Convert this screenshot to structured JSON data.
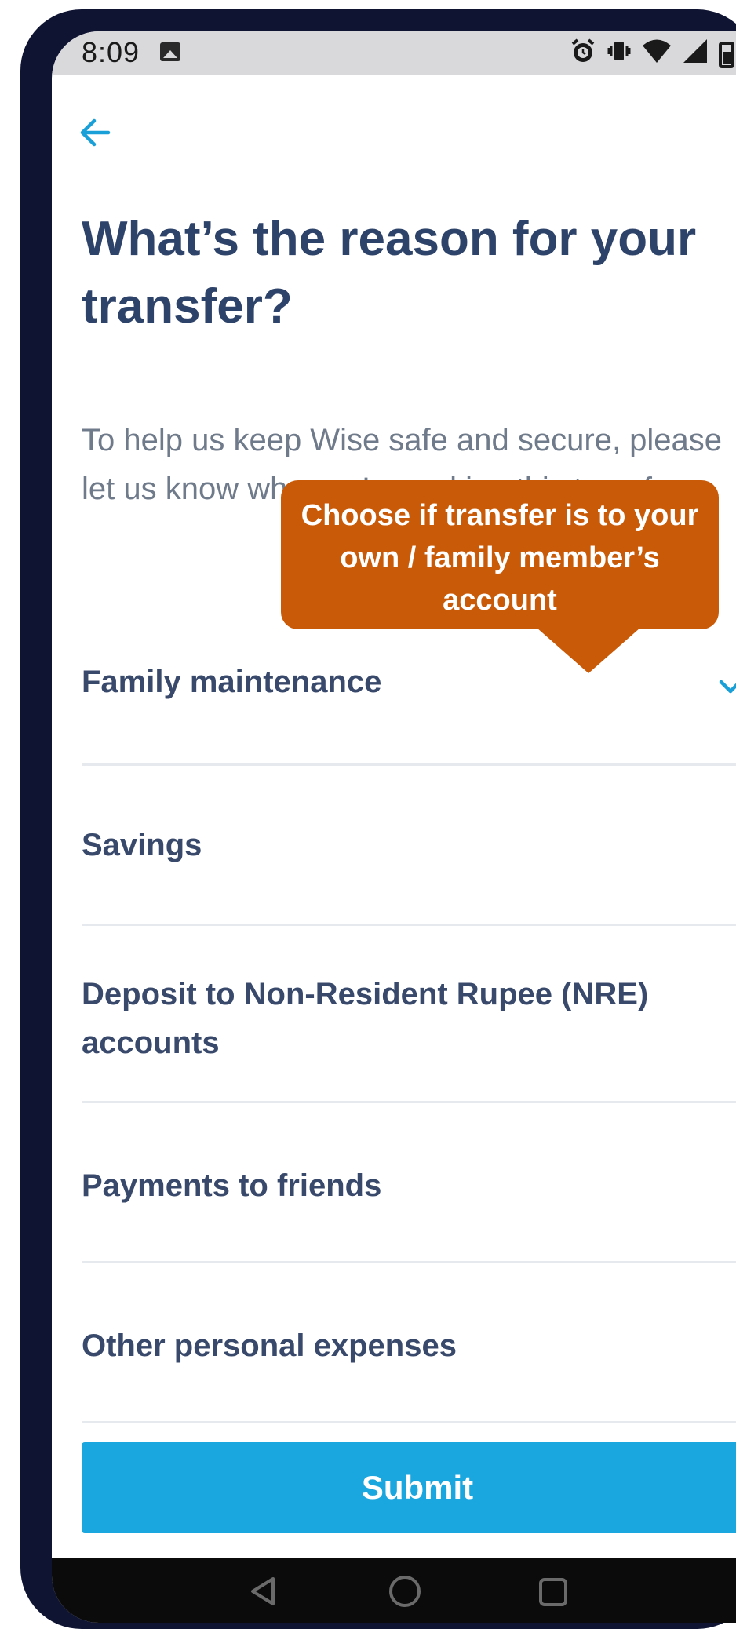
{
  "status_bar": {
    "time": "8:09",
    "icons": [
      "photo-icon",
      "alarm-icon",
      "vibrate-icon",
      "wifi-icon",
      "signal-icon",
      "battery-icon"
    ]
  },
  "header": {
    "back_icon": "arrow-left-icon"
  },
  "title": "What’s the reason for your transfer?",
  "description": "To help us keep Wise safe and secure, please let us know why you’re making this transfer.",
  "reasons": [
    {
      "label": "Family maintenance",
      "selected": true
    },
    {
      "label": "Savings",
      "selected": false
    },
    {
      "label": "Deposit to Non-Resident Rupee (NRE) accounts",
      "selected": false
    },
    {
      "label": "Payments to friends",
      "selected": false
    },
    {
      "label": "Other personal expenses",
      "selected": false
    }
  ],
  "submit_label": "Submit",
  "callout": {
    "text": "Choose if transfer is to your own / family member’s account"
  },
  "nav": {
    "icons": [
      "nav-back-icon",
      "nav-home-icon",
      "nav-recents-icon"
    ]
  },
  "colors": {
    "accent": "#1aa6de",
    "title": "#2e4369",
    "callout": "#c85a08",
    "check": "#1aa0d8"
  }
}
